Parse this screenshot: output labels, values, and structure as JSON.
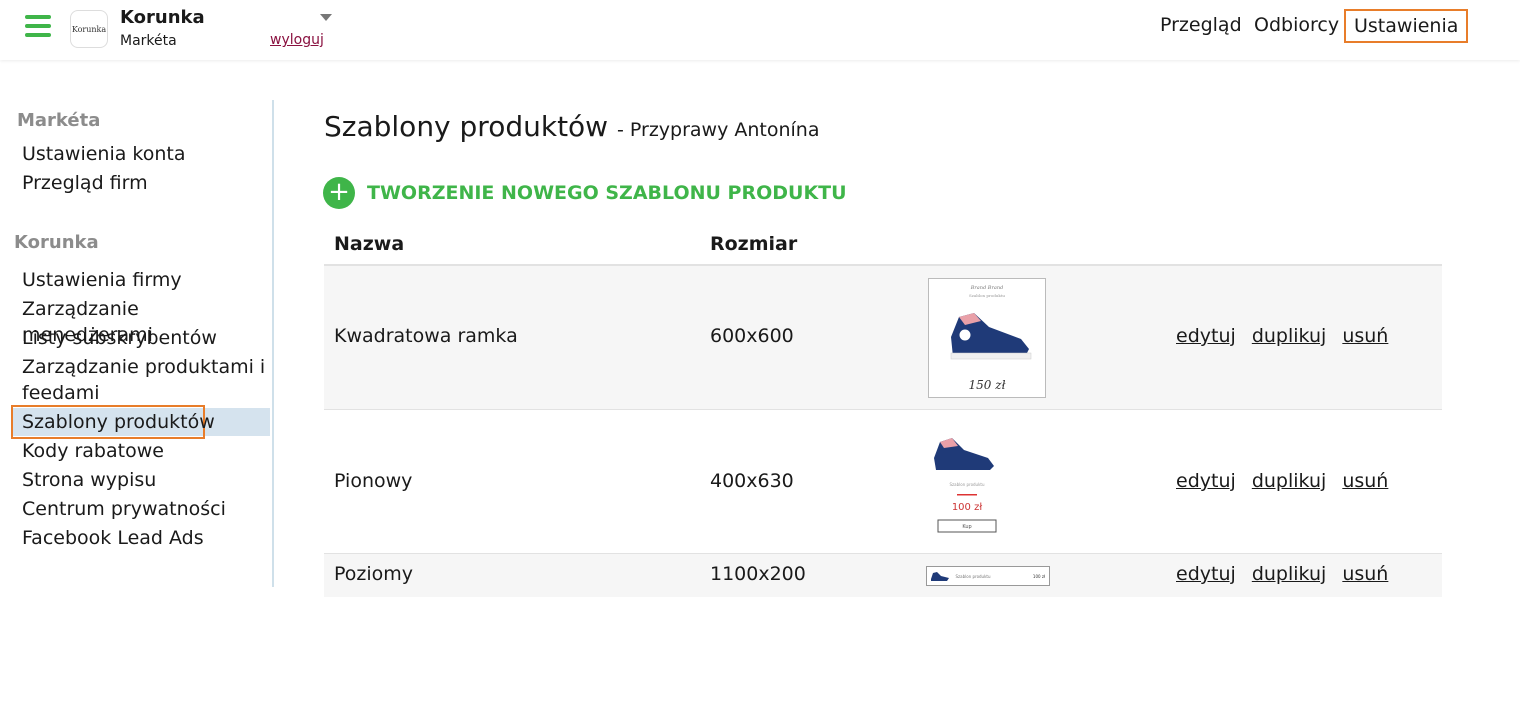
{
  "header": {
    "logo_text": "Korunka",
    "company": "Korunka",
    "user": "Markéta",
    "logout": "wyloguj",
    "nav": [
      "Przegląd",
      "Odbiorcy",
      "Ustawienia"
    ],
    "accent_color": "#3fb549",
    "highlight_color": "#e87d2a"
  },
  "sidebar": {
    "section1": {
      "heading": "Markéta",
      "items": [
        "Ustawienia konta",
        "Przegląd firm"
      ]
    },
    "section2": {
      "heading": "Korunka",
      "items": [
        "Ustawienia firmy",
        "Zarządzanie menedżerami",
        "Listy subskrybentów",
        "Zarządzanie produktami i",
        "feedami",
        "Szablony produktów",
        "Kody rabatowe",
        "Strona wypisu",
        "Centrum prywatności",
        "Facebook Lead Ads"
      ],
      "active": "Szablony produktów"
    }
  },
  "main": {
    "title": "Szablony produktów",
    "subtitle": "- Przyprawy Antonína",
    "add_label": "TWORZENIE NOWEGO SZABLONU PRODUKTU",
    "columns": [
      "Nazwa",
      "Rozmiar"
    ],
    "rows": [
      {
        "name": "Kwadratowa ramka",
        "size": "600x600",
        "thumb_price": "150 zł",
        "thumb_brand": "Brand Brand",
        "thumb_caption": "Szablon produktu",
        "actions": [
          "edytuj",
          "duplikuj",
          "usuń"
        ]
      },
      {
        "name": "Pionowy",
        "size": "400x630",
        "thumb_price": "100 zł",
        "thumb_caption": "Szablon produktu",
        "thumb_button": "Kup",
        "actions": [
          "edytuj",
          "duplikuj",
          "usuń"
        ]
      },
      {
        "name": "Poziomy",
        "size": "1100x200",
        "thumb_caption": "Szablon produktu",
        "thumb_price": "100 zł",
        "actions": [
          "edytuj",
          "duplikuj",
          "usuń"
        ]
      }
    ]
  }
}
